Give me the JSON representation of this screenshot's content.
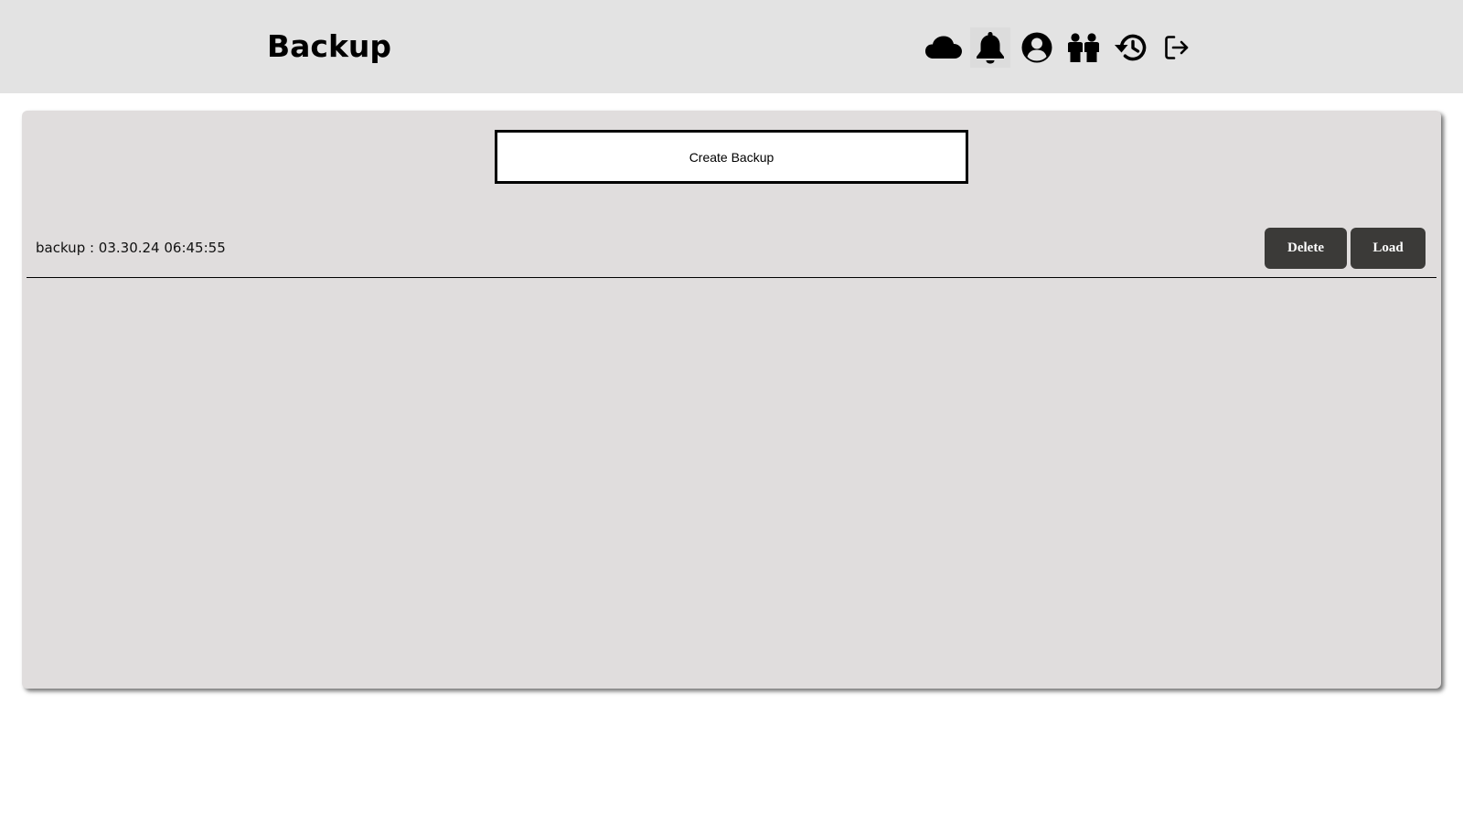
{
  "header": {
    "title": "Backup",
    "icons": [
      {
        "name": "cloud-icon",
        "active": false
      },
      {
        "name": "bell-icon",
        "active": true
      },
      {
        "name": "user-circle-icon",
        "active": false
      },
      {
        "name": "users-icon",
        "active": false
      },
      {
        "name": "history-icon",
        "active": false
      },
      {
        "name": "logout-icon",
        "active": false
      }
    ]
  },
  "main": {
    "create_button_label": "Create Backup",
    "backups": [
      {
        "label": "backup : 03.30.24 06:45:55",
        "delete_label": "Delete",
        "load_label": "Load"
      }
    ]
  },
  "colors": {
    "header_bg": "#e3e3e3",
    "panel_bg": "#e0dddd",
    "button_dark": "#3b3a38"
  }
}
